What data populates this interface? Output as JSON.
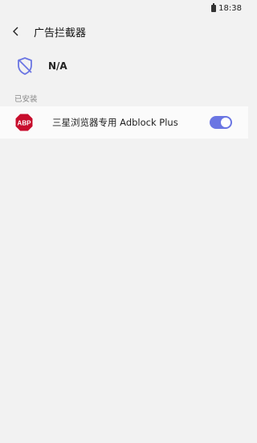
{
  "status_bar": {
    "time": "18:38"
  },
  "header": {
    "title": "广告拦截器"
  },
  "blocker_status": {
    "text": "N/A"
  },
  "installed_section": {
    "label": "已安装",
    "items": [
      {
        "logo_text": "ABP",
        "label": "三星浏览器专用 Adblock Plus",
        "enabled": true
      }
    ]
  },
  "colors": {
    "accent": "#6b76e3",
    "abp_red": "#c70d2c",
    "background": "#f2f2f2"
  }
}
